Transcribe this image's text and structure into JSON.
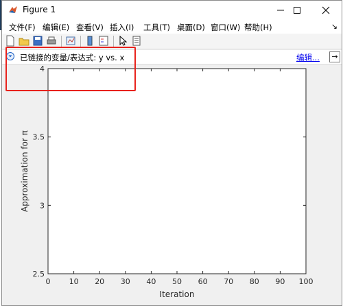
{
  "window": {
    "title": "Figure 1"
  },
  "menu": {
    "items": [
      {
        "label": "文件(F)"
      },
      {
        "label": "编辑(E)"
      },
      {
        "label": "查看(V)"
      },
      {
        "label": "插入(I)"
      },
      {
        "label": "工具(T)"
      },
      {
        "label": "桌面(D)"
      },
      {
        "label": "窗口(W)"
      },
      {
        "label": "帮助(H)"
      }
    ]
  },
  "toolbar": {
    "buttons": [
      "new-figure-icon",
      "open-file-icon",
      "save-icon",
      "print-icon",
      "link-plot-icon",
      "colorbar-icon",
      "legend-icon",
      "pointer-icon",
      "property-editor-icon"
    ]
  },
  "link_bar": {
    "text": "已链接的变量/表达式: y vs. x",
    "edit_label": "编辑...",
    "arrow": "→"
  },
  "chart_data": {
    "type": "line",
    "xlabel": "Iteration",
    "ylabel": "Approximation for π",
    "xlim": [
      0,
      100
    ],
    "ylim": [
      2.5,
      4
    ],
    "xticks": [
      "0",
      "10",
      "20",
      "30",
      "40",
      "50",
      "60",
      "70",
      "80",
      "90",
      "100"
    ],
    "yticks": [
      "2.5",
      "3",
      "3.5",
      "4"
    ],
    "series": [],
    "grid": false
  },
  "colors": {
    "highlight": "#e8221c",
    "link": "#0000ee"
  }
}
